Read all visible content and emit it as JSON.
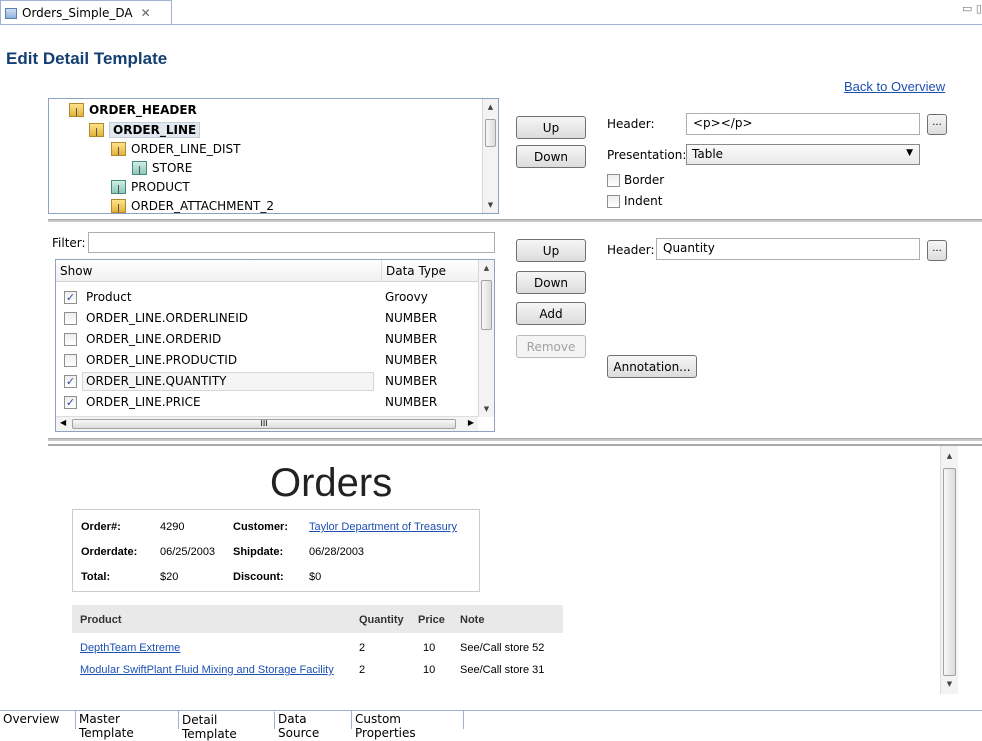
{
  "editor_tab": {
    "label": "Orders_Simple_DA",
    "close": "✕"
  },
  "window_controls": "▭ ▯",
  "page_title": "Edit Detail Template",
  "back_link": "Back to Overview",
  "tree": {
    "items": [
      {
        "label": "ORDER_HEADER",
        "bold": true
      },
      {
        "label": "ORDER_LINE",
        "bold": true,
        "selected": true
      },
      {
        "label": "ORDER_LINE_DIST"
      },
      {
        "label": "STORE"
      },
      {
        "label": "PRODUCT"
      },
      {
        "label": "ORDER_ATTACHMENT_2"
      }
    ]
  },
  "top_buttons": {
    "up": "Up",
    "down": "Down"
  },
  "top_props": {
    "header_label": "Header:",
    "header_value": "<p></p>",
    "dots": "...",
    "presentation_label": "Presentation:",
    "presentation_value": "Table",
    "border_label": "Border",
    "indent_label": "Indent"
  },
  "filter": {
    "label": "Filter:",
    "value": ""
  },
  "grid": {
    "col_show": "Show",
    "col_type": "Data Type",
    "rows": [
      {
        "name": "Product",
        "type": "Groovy",
        "checked": true
      },
      {
        "name": "ORDER_LINE.ORDERLINEID",
        "type": "NUMBER",
        "checked": false
      },
      {
        "name": "ORDER_LINE.ORDERID",
        "type": "NUMBER",
        "checked": false
      },
      {
        "name": "ORDER_LINE.PRODUCTID",
        "type": "NUMBER",
        "checked": false
      },
      {
        "name": "ORDER_LINE.QUANTITY",
        "type": "NUMBER",
        "checked": true
      },
      {
        "name": "ORDER_LINE.PRICE",
        "type": "NUMBER",
        "checked": true
      }
    ],
    "hscroll_mark": "III"
  },
  "mid_buttons": {
    "up": "Up",
    "down": "Down",
    "add": "Add",
    "remove": "Remove",
    "annotation": "Annotation..."
  },
  "mid_props": {
    "header_label": "Header:",
    "header_value": "Quantity",
    "dots": "..."
  },
  "preview": {
    "heading": "Orders",
    "info": {
      "order_no_label": "Order#:",
      "order_no": "4290",
      "customer_label": "Customer:",
      "customer": "Taylor Department of Treasury",
      "orderdate_label": "Orderdate:",
      "orderdate": "06/25/2003",
      "shipdate_label": "Shipdate:",
      "shipdate": "06/28/2003",
      "total_label": "Total:",
      "total": "$20",
      "discount_label": "Discount:",
      "discount": "$0"
    },
    "table": {
      "headers": [
        "Product",
        "Quantity",
        "Price",
        "Note"
      ],
      "rows": [
        {
          "product": "DepthTeam Extreme",
          "quantity": "2",
          "price": "10",
          "note": "See/Call store 52"
        },
        {
          "product": "Modular SwiftPlant Fluid Mixing and Storage Facility",
          "quantity": "2",
          "price": "10",
          "note": "See/Call store 31"
        }
      ]
    }
  },
  "bottom_tabs": [
    "Overview",
    "Master Template",
    "Detail Template",
    "Data Source",
    "Custom Properties"
  ],
  "active_bottom_tab": "Detail Template"
}
